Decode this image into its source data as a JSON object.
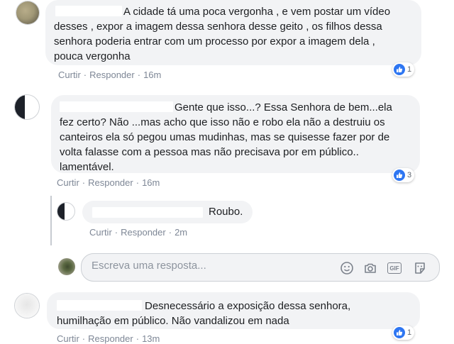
{
  "comments": [
    {
      "text_lines": [
        "A cidade tá uma poca vergonha , e vem postar um vídeo",
        "desses , expor a imagem dessa senhora desse geito , os filhos dessa",
        "senhora poderia entrar com um processo por expor a imagem dela ,",
        "pouca vergonha"
      ],
      "actions": {
        "like": "Curtir",
        "reply": "Responder",
        "dot": "·",
        "time": "16m"
      },
      "reaction_count": "1"
    },
    {
      "text_lines": [
        "Gente que isso...? Essa Senhora de bem...ela",
        "fez certo? Não ...mas acho que isso não e robo ela não a destruiu os",
        "canteiros ela só pegou umas mudinhas, mas se quisesse fazer por de",
        "volta falasse com a pessoa mas não precisava por em público..",
        "lamentável."
      ],
      "actions": {
        "like": "Curtir",
        "reply": "Responder",
        "dot": "·",
        "time": "16m"
      },
      "reaction_count": "3"
    },
    {
      "text_lines": [
        "Desnecessário a exposição dessa senhora,",
        "humilhação em público. Não vandalizou em nada"
      ],
      "actions": {
        "like": "Curtir",
        "reply": "Responder",
        "dot": "·",
        "time": "13m"
      },
      "reaction_count": "1"
    }
  ],
  "reply": {
    "text": "Roubo.",
    "actions": {
      "like": "Curtir",
      "reply": "Responder",
      "dot": "·",
      "time": "2m"
    }
  },
  "reply_input": {
    "placeholder": "Escreva uma resposta...",
    "icons": [
      "emoji-icon",
      "camera-icon",
      "gif-icon",
      "sticker-icon"
    ],
    "gif_label": "GIF"
  },
  "colors": {
    "bubble": "#f2f3f5",
    "action_text": "#7e8796",
    "like_blue": "#2e76f2",
    "thread_line": "#c7cbd1"
  }
}
